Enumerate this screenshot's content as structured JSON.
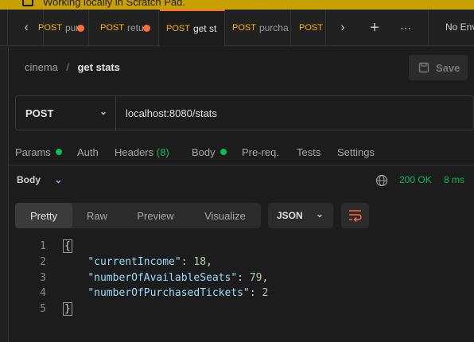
{
  "banner": {
    "text": "Working locally in Scratch Pad."
  },
  "tabs": [
    {
      "method": "POST",
      "name": "pur",
      "dirty": true
    },
    {
      "method": "POST",
      "name": "retu",
      "dirty": true
    },
    {
      "method": "POST",
      "name": "get st",
      "dirty": false,
      "active": true
    },
    {
      "method": "POST",
      "name": "purcha",
      "dirty": false
    },
    {
      "method": "POST",
      "name": "",
      "dirty": false
    }
  ],
  "env": {
    "label": "No Env"
  },
  "breadcrumb": {
    "collection": "cinema",
    "separator": "/",
    "request": "get stats"
  },
  "save": {
    "label": "Save"
  },
  "request": {
    "method": "POST",
    "url": "localhost:8080/stats"
  },
  "request_tabs": {
    "params": "Params",
    "auth": "Auth",
    "headers": "Headers",
    "headers_count": "(8)",
    "body": "Body",
    "prereq": "Pre-req.",
    "tests": "Tests",
    "settings": "Settings"
  },
  "response": {
    "section": "Body",
    "status": "200 OK",
    "time": "8 ms",
    "views": [
      "Pretty",
      "Raw",
      "Preview",
      "Visualize"
    ],
    "active_view": "Pretty",
    "format": "JSON",
    "lines": [
      {
        "n": "1",
        "text": "{"
      },
      {
        "n": "2",
        "key": "\"currentIncome\"",
        "value": "18",
        "comma": ","
      },
      {
        "n": "3",
        "key": "\"numberOfAvailableSeats\"",
        "value": "79",
        "comma": ","
      },
      {
        "n": "4",
        "key": "\"numberOfPurchasedTickets\"",
        "value": "2",
        "comma": ""
      },
      {
        "n": "5",
        "text": "}"
      }
    ]
  },
  "colors": {
    "accent": "#ff6c37",
    "method": "#ffb400",
    "ok": "#0cbb52",
    "banner": "#c8a000"
  }
}
